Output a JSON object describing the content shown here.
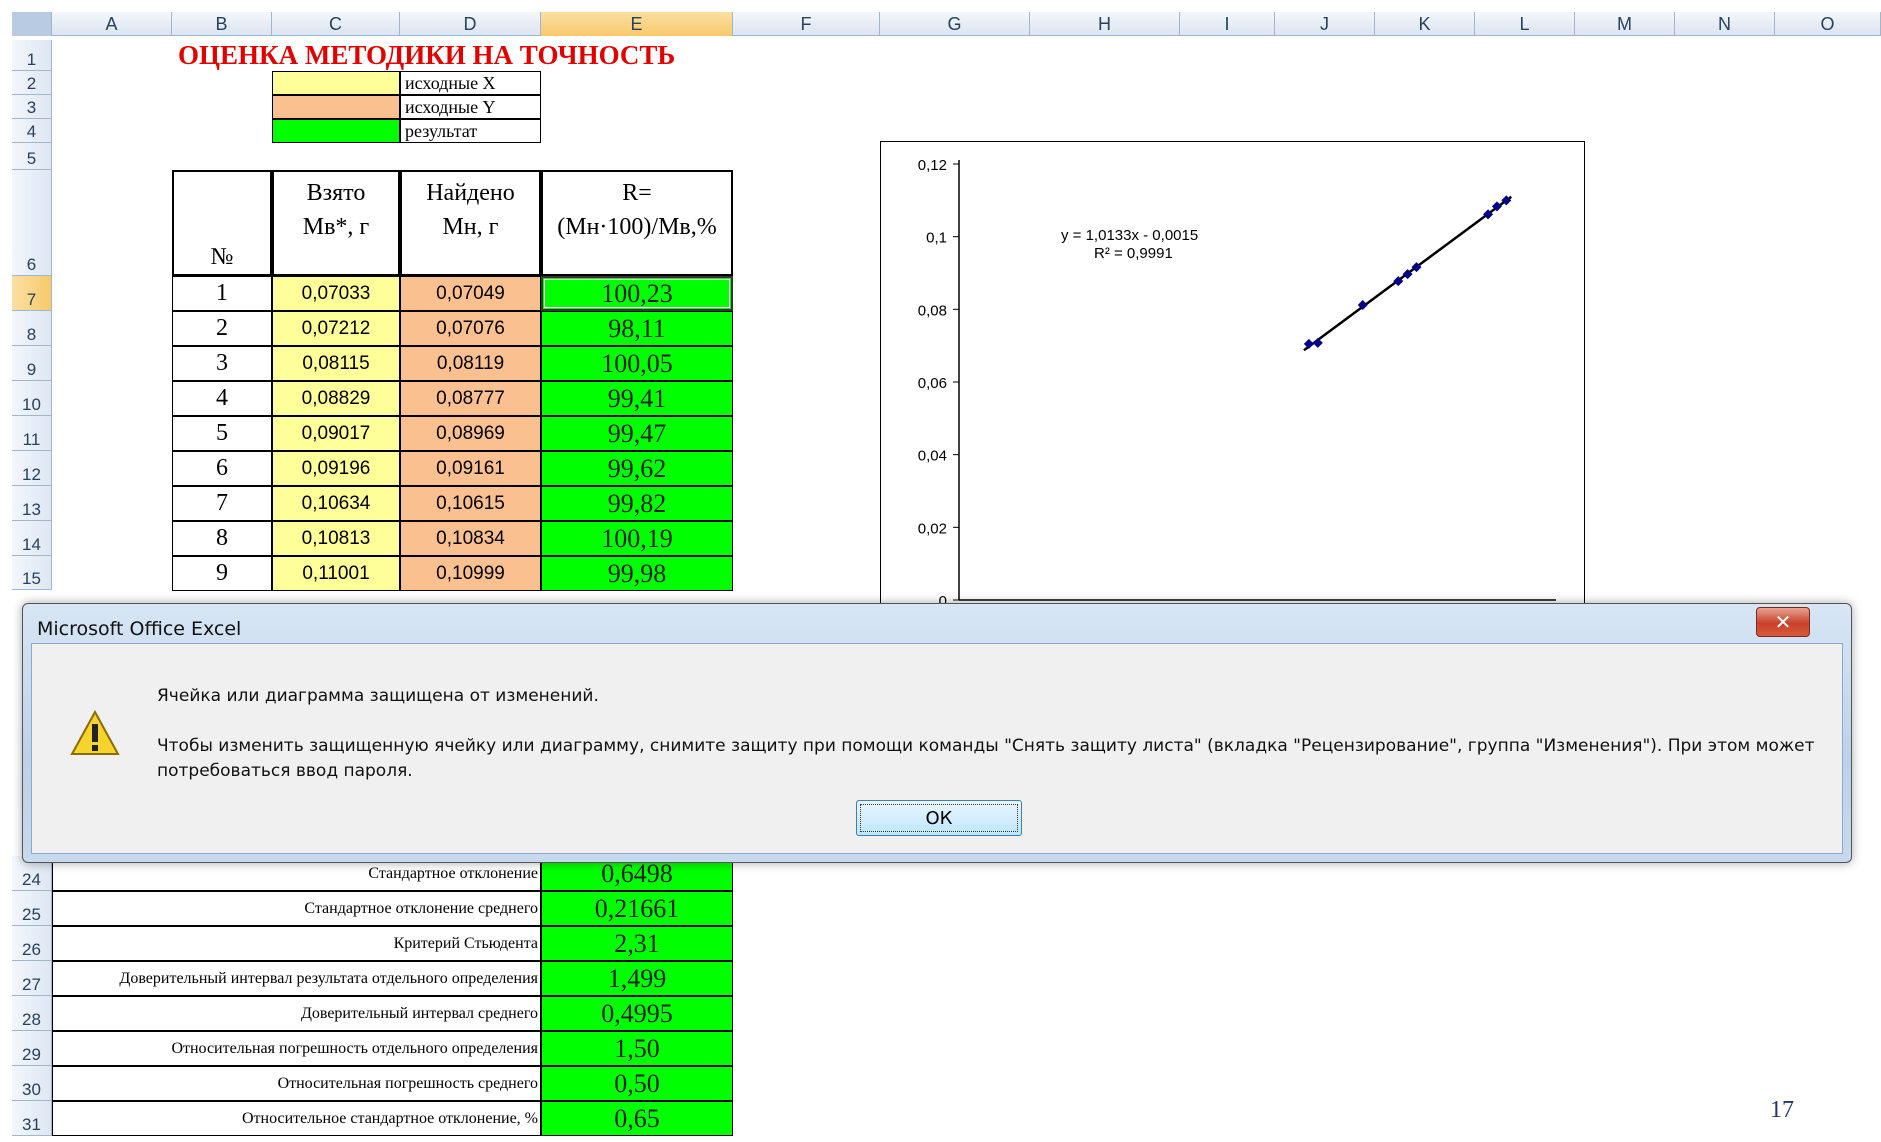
{
  "columns": [
    "A",
    "B",
    "C",
    "D",
    "E",
    "F",
    "G",
    "H",
    "I",
    "J",
    "K",
    "L",
    "M",
    "N",
    "O"
  ],
  "rows_top": [
    "1",
    "2",
    "3",
    "4",
    "5",
    "6",
    "7",
    "8",
    "9",
    "10",
    "11",
    "12",
    "13",
    "14",
    "15"
  ],
  "rows_bottom": [
    "24",
    "25",
    "26",
    "27",
    "28",
    "29",
    "30",
    "31"
  ],
  "sheet": {
    "title": "ОЦЕНКА МЕТОДИКИ НА ТОЧНОСТЬ",
    "legend": [
      "исходные X",
      "исходные Y",
      "результат"
    ],
    "legend_colors": [
      "#ffff99",
      "#fac090",
      "#00ff00"
    ],
    "headers": {
      "no": "№",
      "taken": "Взято\nМв*, г",
      "found": "Найдено\nМн, г",
      "r": "R=\n(Мн·100)/Мв,%"
    },
    "data_rows": [
      {
        "no": "1",
        "taken": "0,07033",
        "found": "0,07049",
        "r": "100,23"
      },
      {
        "no": "2",
        "taken": "0,07212",
        "found": "0,07076",
        "r": "98,11"
      },
      {
        "no": "3",
        "taken": "0,08115",
        "found": "0,08119",
        "r": "100,05"
      },
      {
        "no": "4",
        "taken": "0,08829",
        "found": "0,08777",
        "r": "99,41"
      },
      {
        "no": "5",
        "taken": "0,09017",
        "found": "0,08969",
        "r": "99,47"
      },
      {
        "no": "6",
        "taken": "0,09196",
        "found": "0,09161",
        "r": "99,62"
      },
      {
        "no": "7",
        "taken": "0,10634",
        "found": "0,10615",
        "r": "99,82"
      },
      {
        "no": "8",
        "taken": "0,10813",
        "found": "0,10834",
        "r": "100,19"
      },
      {
        "no": "9",
        "taken": "0,11001",
        "found": "0,10999",
        "r": "99,98"
      }
    ],
    "stats": [
      {
        "label": "Стандартное отклонение",
        "value": "0,6498"
      },
      {
        "label": "Стандартное отклонение среднего",
        "value": "0,21661"
      },
      {
        "label": "Критерий Стьюдента",
        "value": "2,31"
      },
      {
        "label": "Доверительный интервал результата отдельного определения",
        "value": "1,499"
      },
      {
        "label": "Доверительный интервал среднего",
        "value": "0,4995"
      },
      {
        "label": "Относительная погрешность отдельного определения",
        "value": "1,50"
      },
      {
        "label": "Относительная погрешность среднего",
        "value": "0,50"
      },
      {
        "label": "Относительное стандартное отклонение, %",
        "value": "0,65"
      }
    ]
  },
  "chart_data": {
    "type": "scatter",
    "y_ticks": [
      "0",
      "0,02",
      "0,04",
      "0,06",
      "0,08",
      "0,1",
      "0,12"
    ],
    "ylim": [
      0,
      0.12
    ],
    "xlim": [
      0,
      0.12
    ],
    "x": [
      0.07033,
      0.07212,
      0.08115,
      0.08829,
      0.09017,
      0.09196,
      0.10634,
      0.10813,
      0.11001
    ],
    "y": [
      0.07049,
      0.07076,
      0.08119,
      0.08777,
      0.08969,
      0.09161,
      0.10615,
      0.10834,
      0.10999
    ],
    "trendline": {
      "slope": 1.0133,
      "intercept": -0.0015
    },
    "equation": "y = 1,0133x - 0,0015",
    "r2": "R² = 0,9991",
    "point_color": "#00008b"
  },
  "dialog": {
    "title": "Microsoft Office Excel",
    "close": "✕",
    "message1": "Ячейка или диаграмма защищена от изменений.",
    "message2": "Чтобы изменить защищенную ячейку или диаграмму, снимите защиту при помощи команды \"Снять защиту листа\" (вкладка \"Рецензирование\", группа \"Изменения\"). При этом может потребоваться ввод пароля.",
    "icon": "warning-icon",
    "ok": "ОК"
  },
  "page_number": "17"
}
